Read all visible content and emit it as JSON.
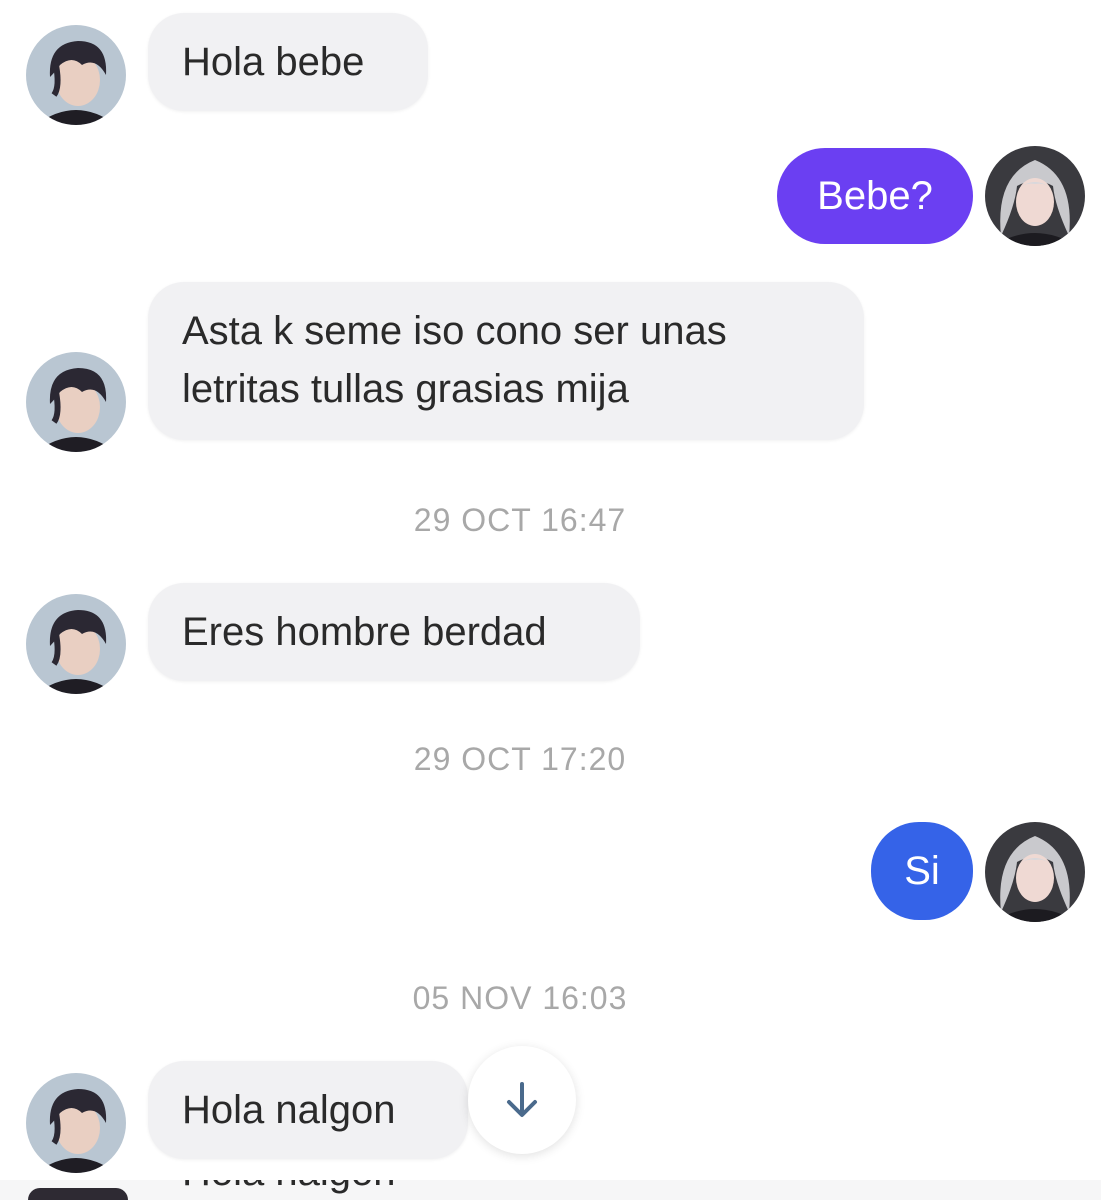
{
  "messages": [
    {
      "side": "in",
      "text": "Hola bebe"
    },
    {
      "side": "out",
      "text": "Bebe?",
      "color": "#6b3ff2"
    },
    {
      "side": "in",
      "line1": "Asta k seme iso cono ser unas",
      "line2": "letritas tullas grasias mija"
    },
    {
      "side": "in",
      "text": "Eres hombre berdad"
    },
    {
      "side": "out",
      "text": "Si",
      "color": "#3563e8"
    },
    {
      "side": "in",
      "text": "Hola nalgon"
    },
    {
      "side": "in",
      "text": "Hola nalgon"
    }
  ],
  "timestamps": [
    "29 OCT 16:47",
    "29 OCT 17:20",
    "05 NOV 16:03"
  ],
  "icons": {
    "scroll": "arrow-down-icon",
    "other_avatar": "dark-haired-avatar",
    "self_avatar": "silver-haired-avatar"
  },
  "colors": {
    "incoming_bubble": "#f1f1f3",
    "outgoing_purple": "#6b3ff2",
    "outgoing_blue": "#3563e8",
    "timestamp": "#a8a8a8"
  }
}
